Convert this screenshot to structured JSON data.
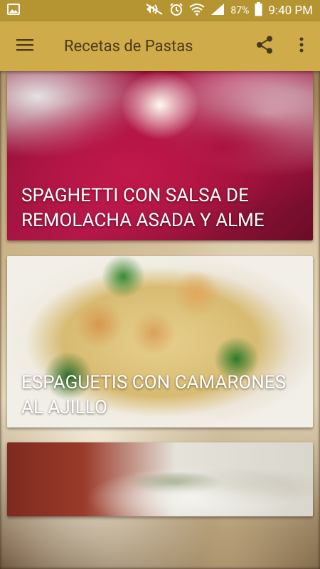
{
  "status_bar": {
    "battery_percent": "87%",
    "time": "9:40 PM",
    "icons": [
      "image-icon",
      "mute-icon",
      "alarm-icon",
      "wifi-icon",
      "signal-icon",
      "battery-icon"
    ]
  },
  "app_bar": {
    "title": "Recetas de Pastas",
    "icons": [
      "menu-icon",
      "share-icon",
      "more-vert-icon"
    ]
  },
  "recipes": [
    {
      "title": "SPAGHETTI CON SALSA DE REMOLACHA ASADA Y ALME",
      "image": "beet-spaghetti"
    },
    {
      "title": "ESPAGUETIS CON CAMARONES AL AJILLO",
      "image": "shrimp-spaghetti"
    },
    {
      "title": "",
      "image": "pasta-plate"
    }
  ],
  "colors": {
    "status_bar": "#b59532",
    "app_bar": "#cfab4a",
    "title_text": "#4a3a1c"
  }
}
